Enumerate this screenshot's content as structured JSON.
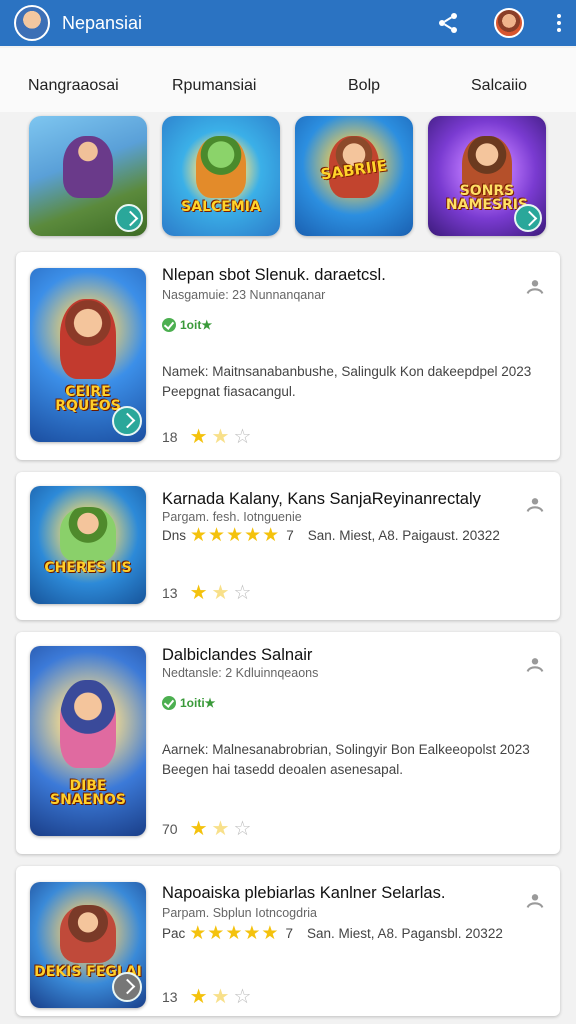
{
  "app": {
    "title": "Nepansiai"
  },
  "tabs": [
    {
      "label": "Nangraaosai"
    },
    {
      "label": "Rpumansiai"
    },
    {
      "label": "Bolp"
    },
    {
      "label": "Salcaiio"
    }
  ],
  "thumbnails": [
    {
      "logo": ""
    },
    {
      "logo": "SALCEMIA"
    },
    {
      "logo": "SABRIIE"
    },
    {
      "logo": "SONRS NAMESRIS"
    }
  ],
  "cards": [
    {
      "title": "Nlepan sbot Slenuk. daraetcsl.",
      "subtitle": "Nasgamuie: 23 Nunnanqanar",
      "badge": "1oit★",
      "description": "Namek: Maitnsanabanbushe, Salingulk Kon dakeepdpel 2023 Peepgnat fiasacangul.",
      "rating_value": "18",
      "art_logo": "CEIRE RQUEOS"
    },
    {
      "title": "Karnada Kalany, Kans SanjaReyinanrectaly",
      "subtitle": "Pargam. fesh. Iotnguenie",
      "meta_prefix": "Dns",
      "meta_count": "7",
      "meta_date": "San. Miest, A8. Paigaust. 20322",
      "rating_value": "13",
      "art_logo": "CHERES IIS"
    },
    {
      "title": "Dalbiclandes Salnair",
      "subtitle": "Nedtansle: 2 Kdluinnqeaons",
      "badge": "1oiti★",
      "description": "Aarnek: Malnesanabrobrian, Solingyir Bon Ealkeeopolst 2023 Beegen hai tasedd deoalen asenesapal.",
      "rating_value": "70",
      "art_logo": "DIBE SNAENOS"
    },
    {
      "title": "Napoaiska plebiarlas Kanlner Selarlas.",
      "subtitle": "Parpam. Sbplun Iotncogdria",
      "meta_prefix": "Pac",
      "meta_count": "7",
      "meta_date": "San. Miest, A8. Pagansbl. 20322",
      "rating_value": "13",
      "art_logo": "DEKIS FEGLAI"
    }
  ],
  "colors": {
    "app_bar": "#2b73c2",
    "star": "#f4c20d",
    "badge_green": "#4caf50",
    "go_button": "#2aa79a"
  }
}
